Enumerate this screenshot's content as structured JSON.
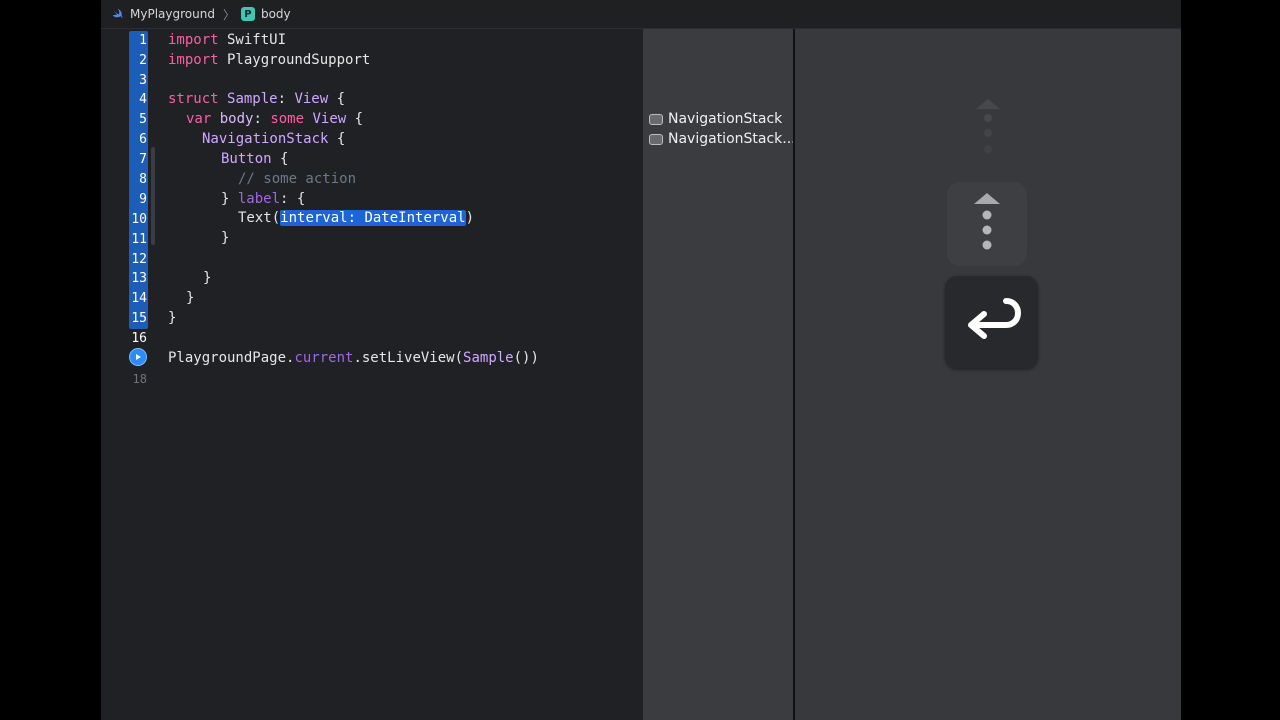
{
  "breadcrumb": {
    "project": "MyPlayground",
    "page": "body",
    "page_icon_letter": "P"
  },
  "editor": {
    "line_numbers": [
      "1",
      "2",
      "3",
      "4",
      "5",
      "6",
      "7",
      "8",
      "9",
      "10",
      "11",
      "12",
      "13",
      "14",
      "15",
      "16",
      "18"
    ],
    "lines": [
      [
        "import",
        " SwiftUI"
      ],
      [
        "import",
        " PlaygroundSupport"
      ],
      [
        "struct",
        " ",
        "Sample",
        ": ",
        "View",
        " {"
      ],
      [
        "var",
        " ",
        "body",
        ": ",
        "some",
        " ",
        "View",
        " {"
      ],
      [
        "NavigationStack",
        " {"
      ],
      [
        "Button",
        " {"
      ],
      [
        "// some action"
      ],
      [
        "} ",
        "label",
        ": {"
      ],
      [
        "Text(",
        "interval: DateInterval",
        ")"
      ],
      [
        "}"
      ],
      [
        "}"
      ],
      [
        "}"
      ],
      [
        "}"
      ],
      [
        "PlaygroundPage.",
        "current",
        ".setLiveView(",
        "Sample",
        "())"
      ]
    ]
  },
  "results": {
    "items": [
      "NavigationStack",
      "NavigationStack..."
    ]
  },
  "colors": {
    "keyword": "#fc5fa3",
    "type": "#d0a8ff",
    "comment": "#6c7986",
    "selection": "#1d64d8",
    "gutter_highlight": "#1d5db5"
  },
  "icons": [
    "swift-icon",
    "playground-page-icon",
    "run-icon",
    "result-view-icon",
    "scroll-up-key-icon",
    "return-key-icon"
  ]
}
